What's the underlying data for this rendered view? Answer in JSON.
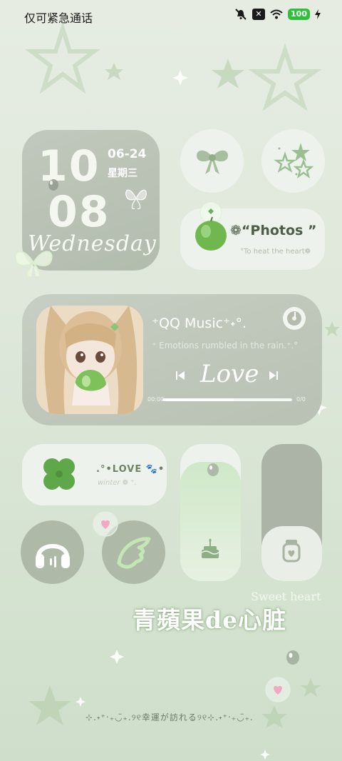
{
  "status_bar": {
    "carrier_text": "仅可紧急通话",
    "battery": "100",
    "icons": [
      "mute-icon",
      "sim-x-icon",
      "wifi-icon",
      "battery-icon",
      "charging-icon"
    ]
  },
  "clock": {
    "hour": "10",
    "minute": "08",
    "date": "06-24",
    "weekday_cn": "星期三",
    "weekday_en": "Wednesday"
  },
  "shortcuts": {
    "bow_icon": "bow-icon",
    "stars_icon": "stars-icon"
  },
  "photos": {
    "title": "❁“Photos ”",
    "subtitle": "°To heat the heart❁"
  },
  "music": {
    "title": "⁺QQ Music⁺˖°.",
    "lyric": "⁺ Emotions rumbled in the rain.⁺.°",
    "love_text": "Love",
    "time_current": "00:00",
    "time_total": "0/0",
    "progress": 0.55
  },
  "love_widget": {
    "title": ".°•LOVE 🐾•",
    "subtitle": "winter ❁ ⁺."
  },
  "sliders": {
    "left_level": 0.87,
    "right_level": 0.4,
    "left_icon": "cake-icon",
    "right_icon": "jar-heart-icon"
  },
  "decor": {
    "sweet_heart": "Sweet heart",
    "cn_text": "青蘋果de心脏",
    "bottom_text": "⊹.˖⁺‧₊◡̈₊.୨୧幸運が訪れる୨୧⊹.˖⁺‧₊◡̈₊."
  },
  "colors": {
    "background": "#dfe8db",
    "widget_light": "#eef2ec",
    "widget_dark": "#aeb9a8",
    "accent_green": "#8fbf7f"
  }
}
